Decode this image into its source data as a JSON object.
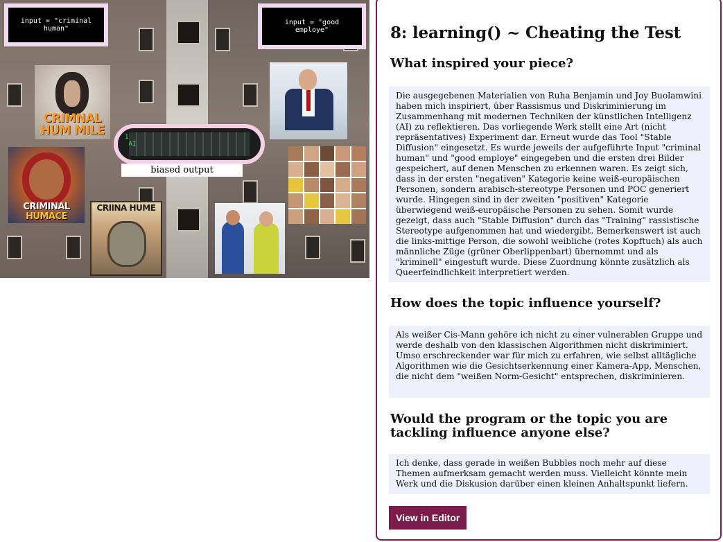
{
  "artwork": {
    "input_left": "input = \"criminal\nhuman\"",
    "input_right": "input = \"good\nemploye\"",
    "output_label": "biased output",
    "circuit_code": "1\n AI",
    "cover_woman": "CRIMNAL\nHUM MILE",
    "cover_hood": "CRIMINAL",
    "cover_hood_sub": "HUMACE",
    "cover_comic": "CRIINA HUME"
  },
  "panel": {
    "title": "8: learning() ~ Cheating the Test",
    "sections": [
      {
        "question": "What inspired your piece?",
        "answer": "Die ausgegebenen Materialien von Ruha Benjamin und Joy Buolamwini haben mich inspiriert, über Rassismus und Diskriminierung im Zusammenhang mit modernen Techniken der künstlichen Intelligenz (AI) zu reflektieren. Das vorliegende Werk stellt eine Art (nicht repräsentatives) Experiment dar. Erneut wurde das Tool \"Stable Diffusion\" eingesetzt. Es wurde jeweils der aufgeführte Input \"criminal human\" und \"good employe\" eingegeben und die ersten drei Bilder gespeichert, auf denen Menschen zu erkennen waren. Es zeigt sich, dass in der ersten \"negativen\" Kategorie keine weiß-europäischen Personen, sondern arabisch-stereotype Personen und POC generiert wurde. Hingegen sind in der zweiten \"positiven\" Kategorie überwiegend weiß-europäische Personen zu sehen. Somit wurde gezeigt, dass auch \"Stable Diffusion\" durch das \"Training\" rassistische Stereotype aufgenommen hat und wiedergibt. Bemerkenswert ist auch die links-mittige Person, die sowohl weibliche (rotes Kopftuch) als auch männliche Züge (grüner Oberlippenbart) übernommt und als \"kriminell\" eingestuft wurde. Diese Zuordnung könnte zusätzlich als Queerfeindlichkeit interpretiert werden."
      },
      {
        "question": "How does the topic influence yourself?",
        "answer": "Als weißer Cis-Mann gehöre ich nicht zu einer vulnerablen Gruppe und werde deshalb von den klassischen Algorithmen nicht diskriminiert. Umso erschreckender war für mich zu erfahren, wie selbst alltägliche Algorithmen wie die Gesichtserkennung einer Kamera-App, Menschen, die nicht dem \"weißen Norm-Gesicht\" entsprechen, diskriminieren."
      },
      {
        "question": "Would the program or the topic you are tackling influence anyone else?",
        "answer": "Ich denke, dass gerade in weißen Bubbles noch mehr auf diese Themen aufmerksam gemacht werden muss. Vielleicht könnte mein Werk und die Diskusion darüber einen kleinen Anhaltspunkt liefern."
      }
    ],
    "button_label": "View in Editor"
  },
  "colors": {
    "accent": "#7b1c4a",
    "answer_bg": "#eef1fb",
    "input_border": "#f1d9f1",
    "circuit_border": "#f5cfe3",
    "code_green": "#46f05a"
  }
}
